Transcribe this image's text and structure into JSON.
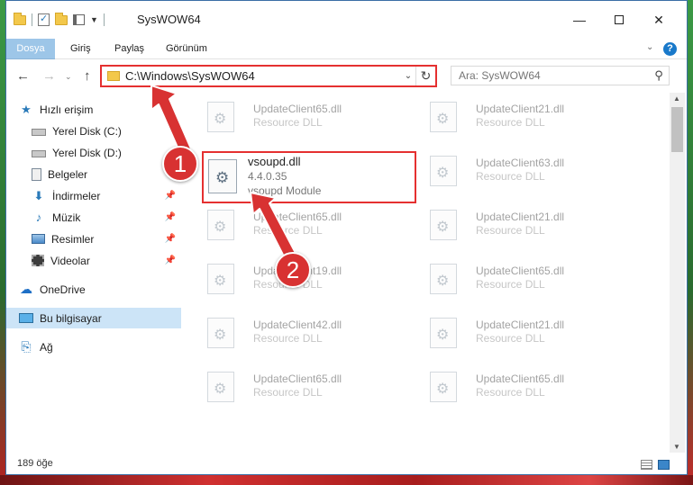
{
  "window": {
    "title": "SysWOW64"
  },
  "ribbon": {
    "tabs": [
      {
        "label": "Dosya"
      },
      {
        "label": "Giriş"
      },
      {
        "label": "Paylaş"
      },
      {
        "label": "Görünüm"
      }
    ]
  },
  "navigation": {
    "address": "C:\\Windows\\SysWOW64",
    "search_placeholder": "Ara: SysWOW64"
  },
  "sidebar": {
    "items": [
      {
        "label": "Hızlı erişim",
        "icon": "star-icon"
      },
      {
        "label": "Yerel Disk (C:)",
        "icon": "drive-icon"
      },
      {
        "label": "Yerel Disk (D:)",
        "icon": "drive-icon"
      },
      {
        "label": "Belgeler",
        "icon": "document-icon"
      },
      {
        "label": "İndirmeler",
        "icon": "download-icon"
      },
      {
        "label": "Müzik",
        "icon": "music-icon"
      },
      {
        "label": "Resimler",
        "icon": "pictures-icon"
      },
      {
        "label": "Videolar",
        "icon": "videos-icon"
      },
      {
        "label": "OneDrive",
        "icon": "cloud-icon"
      },
      {
        "label": "Bu bilgisayar",
        "icon": "computer-icon"
      },
      {
        "label": "Ağ",
        "icon": "network-icon"
      }
    ]
  },
  "files": {
    "items": [
      {
        "name": "UpdateClient65.dll",
        "type": "Resource DLL"
      },
      {
        "name": "UpdateClient21.dll",
        "type": "Resource DLL"
      },
      {
        "name": "UpdateClient63.dll",
        "type": "Resource DLL"
      },
      {
        "name": "UpdateClient65.dll",
        "type": "Resource DLL"
      },
      {
        "name": "UpdateClient21.dll",
        "type": "Resource DLL"
      },
      {
        "name": "UpdateClient19.dll",
        "type": "Resource DLL"
      },
      {
        "name": "UpdateClient65.dll",
        "type": "Resource DLL"
      },
      {
        "name": "UpdateClient42.dll",
        "type": "Resource DLL"
      },
      {
        "name": "UpdateClient21.dll",
        "type": "Resource DLL"
      },
      {
        "name": "UpdateClient65.dll",
        "type": "Resource DLL"
      },
      {
        "name": "UpdateClient65.dll",
        "type": "Resource DLL"
      }
    ],
    "highlighted": {
      "name": "vsoupd.dll",
      "version": "4.4.0.35",
      "description": "vsoupd Module"
    }
  },
  "status": {
    "item_count": "189 öğe"
  },
  "annotations": {
    "step1": "1",
    "step2": "2",
    "color": "#d83232"
  }
}
